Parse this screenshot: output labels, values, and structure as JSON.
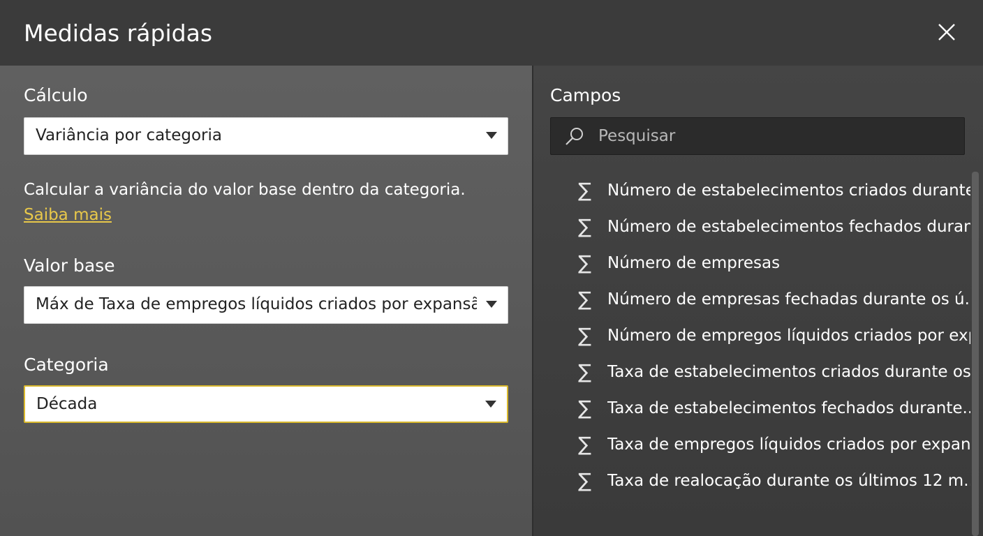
{
  "dialog": {
    "title": "Medidas rápidas",
    "close_icon": "close-icon"
  },
  "left": {
    "calc_label": "Cálculo",
    "calc_value": "Variância por categoria",
    "description": "Calcular a variância do valor base dentro da categoria.",
    "learn_more": "Saiba mais",
    "base_label": "Valor base",
    "base_value": "Máx de Taxa de empregos líquidos criados por expansão...",
    "category_label": "Categoria",
    "category_value": "Década"
  },
  "right": {
    "fields_label": "Campos",
    "search_placeholder": "Pesquisar",
    "fields": [
      "Número de estabelecimentos criados durante...",
      "Número de estabelecimentos fechados durant...",
      "Número de empresas",
      "Número de empresas fechadas durante os ú...",
      "Número de empregos líquidos criados por exp...",
      "Taxa de estabelecimentos criados durante os...",
      "Taxa de estabelecimentos fechados durante...",
      "Taxa de empregos líquidos criados por expans...",
      "Taxa de realocação durante os últimos 12 m..."
    ],
    "field_icon": "sigma-icon"
  },
  "colors": {
    "link": "#e8c84a",
    "focus_border": "#d9b82c",
    "title_bar": "#3b3b3b",
    "left_pane": "#5b5b5b",
    "right_pane": "#3f3f3f"
  }
}
